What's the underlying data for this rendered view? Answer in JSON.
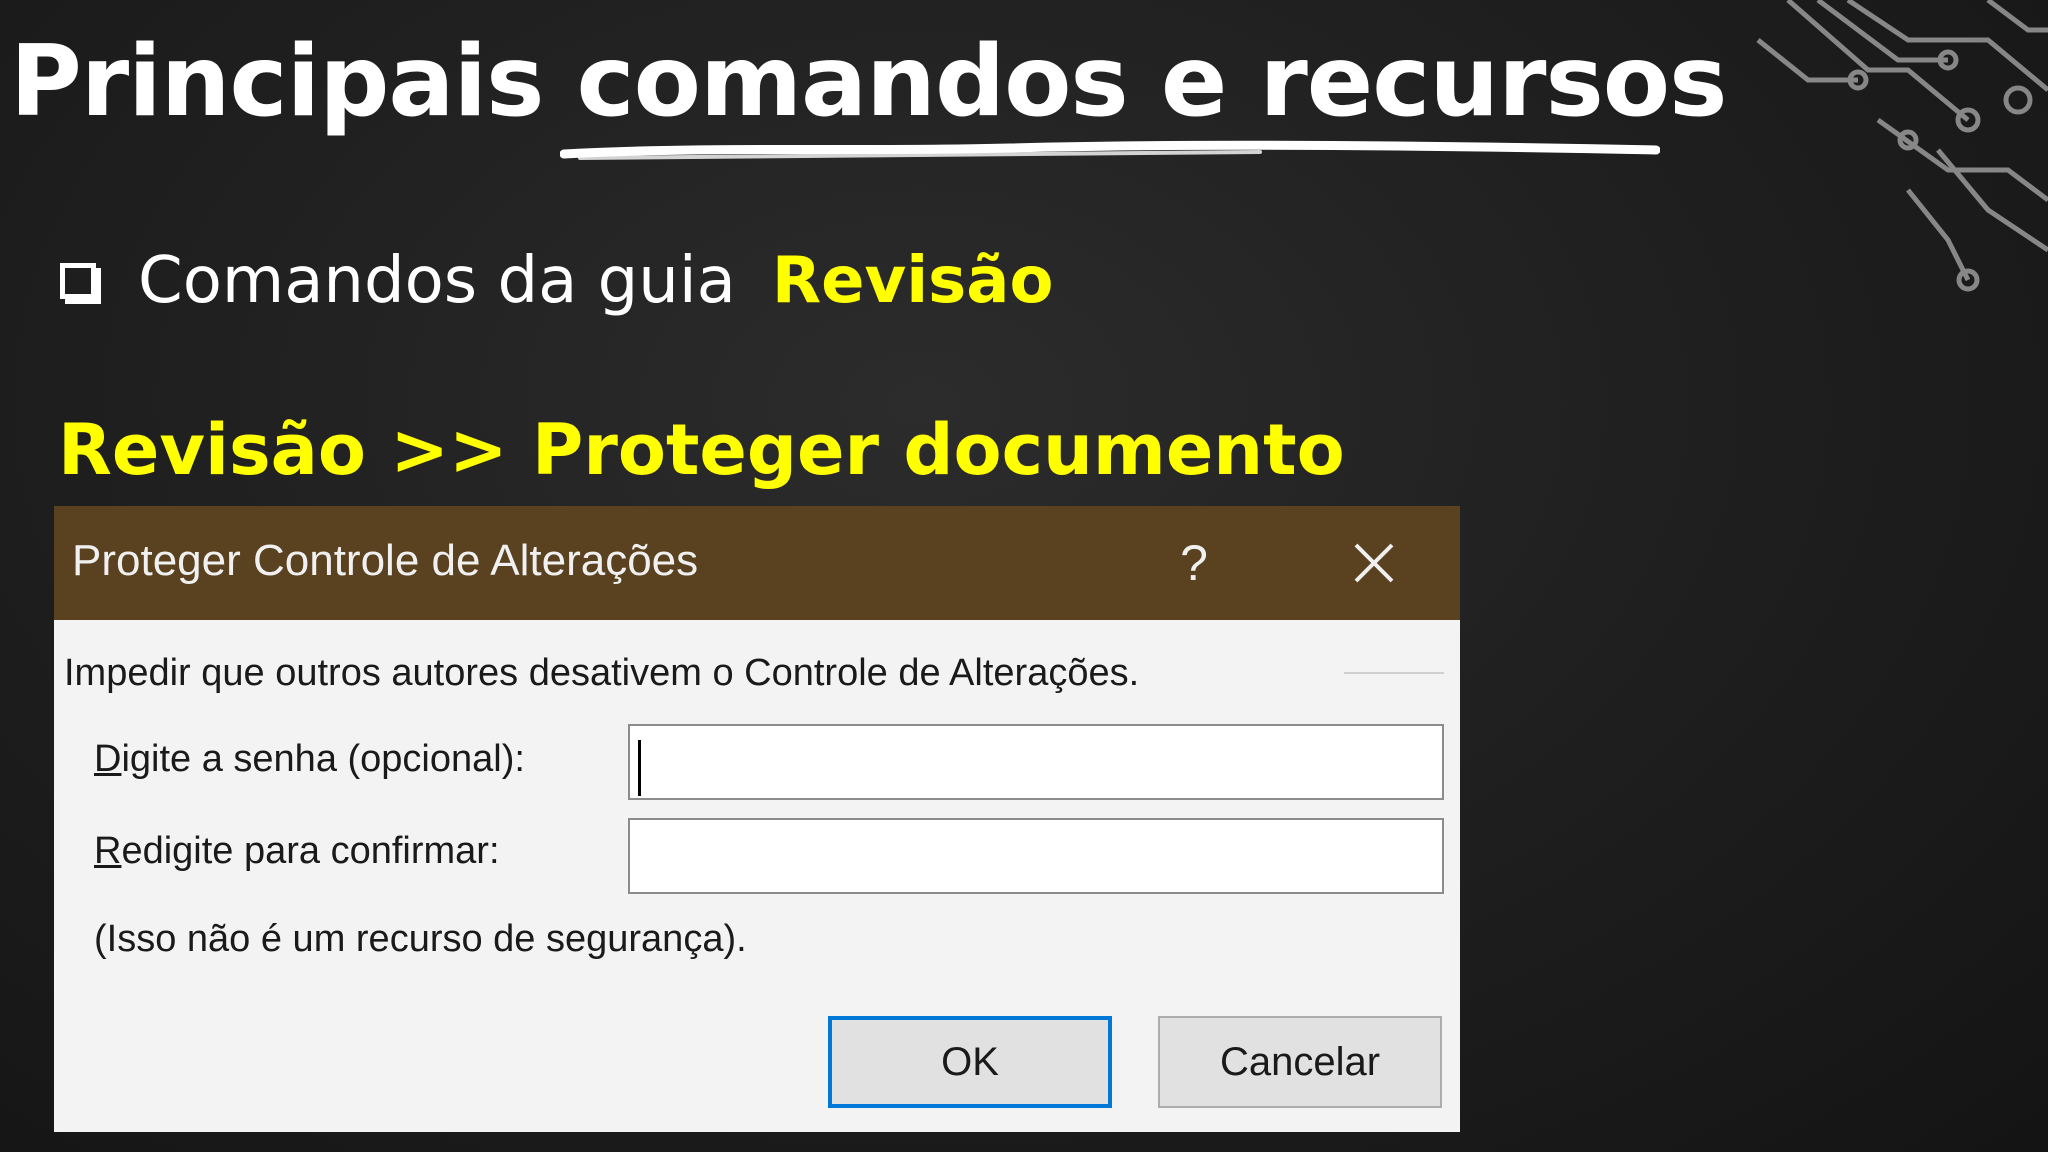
{
  "slide": {
    "title": "Principais comandos e recursos",
    "bullet_text": "Comandos da guia",
    "bullet_highlight": "Revisão",
    "subheading": "Revisão >> Proteger documento"
  },
  "dialog": {
    "title": "Proteger Controle de Alterações",
    "help_label": "?",
    "description": "Impedir que outros autores desativem o Controle de Alterações.",
    "password_label_mnemonic": "D",
    "password_label_rest": "igite a senha (opcional):",
    "password_value": "",
    "confirm_label_mnemonic": "R",
    "confirm_label_rest": "edigite para confirmar:",
    "confirm_value": "",
    "note": "(Isso não é um recurso de segurança).",
    "ok_label": "OK",
    "cancel_label": "Cancelar"
  },
  "colors": {
    "highlight": "#ffff00",
    "titlebar": "#5a4220",
    "default_button_border": "#0078d7"
  },
  "icons": [
    "checkbox-bullet-icon",
    "close-icon",
    "circuit-decoration-icon"
  ]
}
